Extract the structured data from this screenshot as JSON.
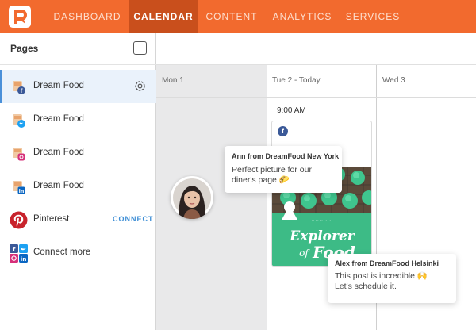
{
  "nav": {
    "items": [
      {
        "label": "DASHBOARD",
        "active": false
      },
      {
        "label": "CALENDAR",
        "active": true
      },
      {
        "label": "CONTENT",
        "active": false
      },
      {
        "label": "ANALYTICS",
        "active": false
      },
      {
        "label": "SERVICES",
        "active": false
      }
    ],
    "colors": {
      "bar": "#f26a2e",
      "active": "#c94f1c"
    }
  },
  "sidebar": {
    "title": "Pages",
    "pages": [
      {
        "label": "Dream Food",
        "network": "facebook",
        "active": true
      },
      {
        "label": "Dream Food",
        "network": "twitter",
        "active": false
      },
      {
        "label": "Dream Food",
        "network": "instagram",
        "active": false
      },
      {
        "label": "Dream Food",
        "network": "linkedin",
        "active": false
      },
      {
        "label": "Pinterest",
        "network": "pinterest",
        "action": "CONNECT"
      },
      {
        "label": "Connect more",
        "network": "multi"
      }
    ]
  },
  "calendar": {
    "days": [
      "Mon 1",
      "Tue 2 - Today",
      "Wed 3"
    ],
    "post": {
      "time": "9:00 AM",
      "network": "facebook",
      "image_text": {
        "line1": "Explorer",
        "line2": "of",
        "line3": "Food"
      }
    }
  },
  "comments": [
    {
      "author": "Ann from DreamFood New York",
      "text": "Perfect picture for our diner's page 🌮"
    },
    {
      "author": "Alex from DreamFood Helsinki",
      "line1": "This post is incredible 🙌",
      "line2": "Let's schedule it."
    }
  ]
}
